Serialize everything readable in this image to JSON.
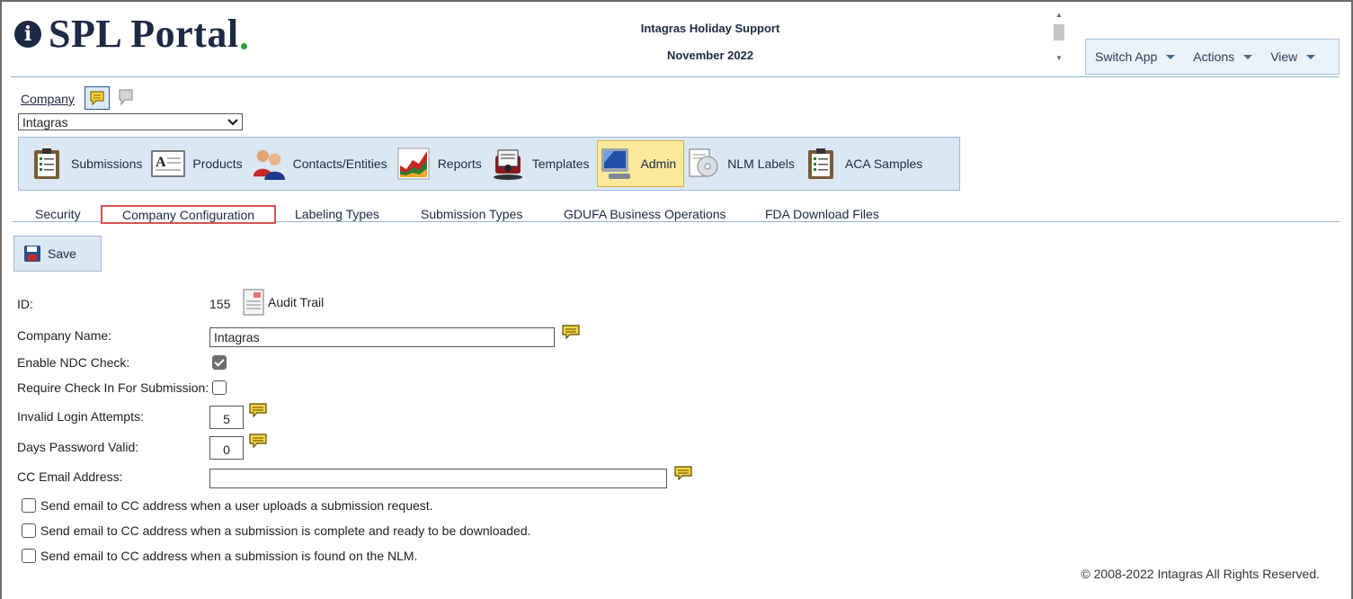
{
  "logo": {
    "text": "SPL Portal",
    "accent": "#2e9d3b",
    "brand": "#1d2a44"
  },
  "header": {
    "title": "Intagras Holiday Support",
    "subtitle": "November 2022"
  },
  "menu": [
    {
      "label": "Switch App"
    },
    {
      "label": "Actions"
    },
    {
      "label": "View"
    }
  ],
  "company": {
    "label": "Company",
    "selected": "Intagras"
  },
  "modules": [
    {
      "label": "Submissions",
      "icon": "clipboard-icon"
    },
    {
      "label": "Products",
      "icon": "document-a-icon"
    },
    {
      "label": "Contacts/Entities",
      "icon": "people-icon"
    },
    {
      "label": "Reports",
      "icon": "chart-icon"
    },
    {
      "label": "Templates",
      "icon": "rolodex-icon"
    },
    {
      "label": "Admin",
      "icon": "monitor-icon",
      "active": true
    },
    {
      "label": "NLM Labels",
      "icon": "label-cd-icon"
    },
    {
      "label": "ACA Samples",
      "icon": "clipboard-icon"
    }
  ],
  "tabs": [
    {
      "label": "Security"
    },
    {
      "label": "Company Configuration",
      "selected": true
    },
    {
      "label": "Labeling Types"
    },
    {
      "label": "Submission Types"
    },
    {
      "label": "GDUFA Business Operations"
    },
    {
      "label": "FDA Download Files"
    }
  ],
  "toolbar": {
    "save_label": "Save"
  },
  "form": {
    "id_label": "ID:",
    "id_value": "155",
    "audit_trail": "Audit Trail",
    "company_name_label": "Company Name:",
    "company_name_value": "Intagras",
    "enable_ndc_label": "Enable NDC Check:",
    "enable_ndc_checked": true,
    "require_checkin_label": "Require Check In For Submission:",
    "require_checkin_checked": false,
    "invalid_login_label": "Invalid Login Attempts:",
    "invalid_login_value": "5",
    "days_password_label": "Days Password Valid:",
    "days_password_value": "0",
    "cc_email_label": "CC Email Address:",
    "cc_email_value": ""
  },
  "email_options": [
    {
      "label": "Send email to CC address when a user uploads a submission request.",
      "checked": false
    },
    {
      "label": "Send email to CC address when a submission is complete and ready to be downloaded.",
      "checked": false
    },
    {
      "label": "Send email to CC address when a submission is found on the NLM.",
      "checked": false
    }
  ],
  "footer": {
    "copyright": "© 2008-2022 Intagras All Rights Reserved."
  }
}
